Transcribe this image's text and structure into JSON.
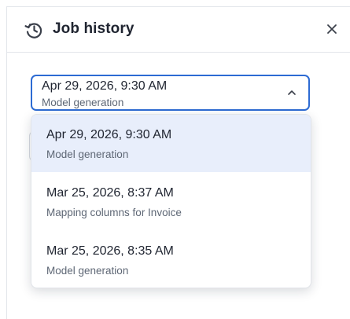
{
  "header": {
    "title": "Job history",
    "icon": "history-icon",
    "close_icon": "close-icon"
  },
  "select": {
    "value_primary": "Apr 29, 2026, 9:30 AM",
    "value_secondary": "Model generation",
    "icon": "chevron-up-icon"
  },
  "options": [
    {
      "primary": "Apr 29, 2026, 9:30 AM",
      "secondary": "Model generation",
      "selected": true
    },
    {
      "primary": "Mar 25, 2026, 8:37 AM",
      "secondary": "Mapping columns for Invoice",
      "selected": false
    },
    {
      "primary": "Mar 25, 2026, 8:35 AM",
      "secondary": "Model generation",
      "selected": false
    }
  ],
  "colors": {
    "accent": "#2d6bd3",
    "selected_bg": "#e8eefb",
    "secondary_text": "#5e6775"
  }
}
